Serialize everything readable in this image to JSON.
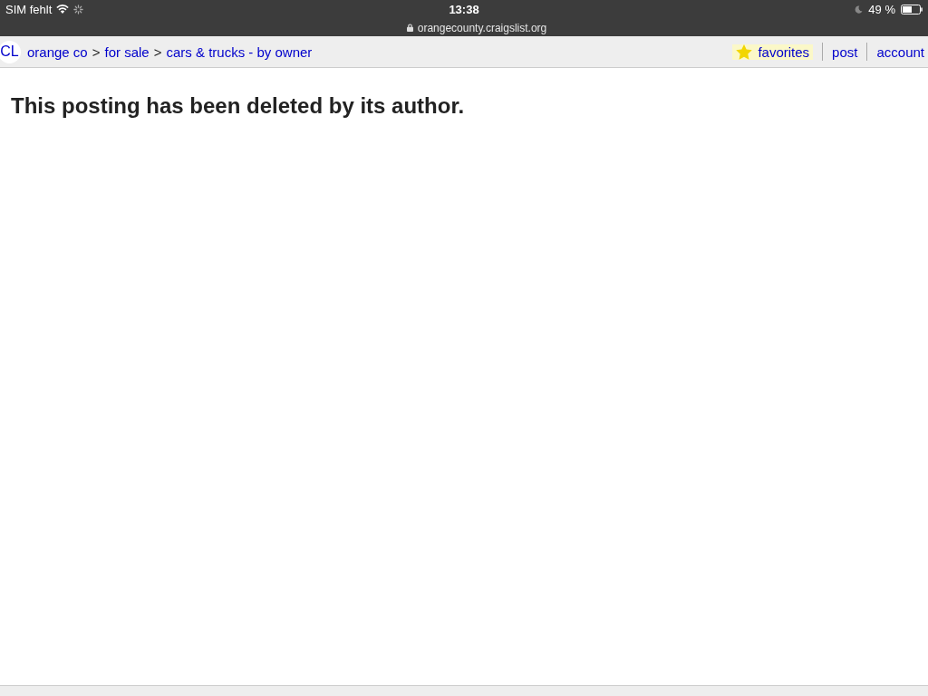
{
  "status_bar": {
    "carrier": "SIM fehlt",
    "time": "13:38",
    "url": "orangecounty.craigslist.org",
    "battery": "49 %"
  },
  "nav": {
    "logo": "CL",
    "breadcrumbs": [
      {
        "kind": "link",
        "text": "orange co"
      },
      {
        "kind": "separator",
        "text": ">"
      },
      {
        "kind": "link",
        "text": "for sale"
      },
      {
        "kind": "separator",
        "text": ">"
      },
      {
        "kind": "link",
        "text": "cars & trucks - by owner"
      }
    ],
    "links": [
      {
        "kind": "favorites",
        "text": "favorites"
      },
      {
        "kind": "plain",
        "text": "post"
      },
      {
        "kind": "plain",
        "text": "account"
      }
    ]
  },
  "message": "This posting has been deleted by its author."
}
